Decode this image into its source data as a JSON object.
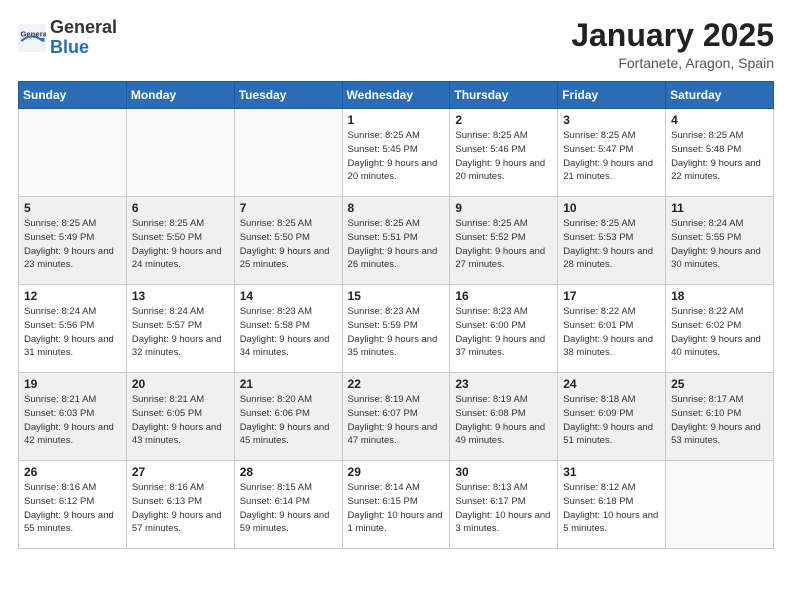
{
  "header": {
    "logo_general": "General",
    "logo_blue": "Blue",
    "month": "January 2025",
    "location": "Fortanete, Aragon, Spain"
  },
  "weekdays": [
    "Sunday",
    "Monday",
    "Tuesday",
    "Wednesday",
    "Thursday",
    "Friday",
    "Saturday"
  ],
  "weeks": [
    [
      {
        "day": "",
        "sunrise": "",
        "sunset": "",
        "daylight": ""
      },
      {
        "day": "",
        "sunrise": "",
        "sunset": "",
        "daylight": ""
      },
      {
        "day": "",
        "sunrise": "",
        "sunset": "",
        "daylight": ""
      },
      {
        "day": "1",
        "sunrise": "Sunrise: 8:25 AM",
        "sunset": "Sunset: 5:45 PM",
        "daylight": "Daylight: 9 hours and 20 minutes."
      },
      {
        "day": "2",
        "sunrise": "Sunrise: 8:25 AM",
        "sunset": "Sunset: 5:46 PM",
        "daylight": "Daylight: 9 hours and 20 minutes."
      },
      {
        "day": "3",
        "sunrise": "Sunrise: 8:25 AM",
        "sunset": "Sunset: 5:47 PM",
        "daylight": "Daylight: 9 hours and 21 minutes."
      },
      {
        "day": "4",
        "sunrise": "Sunrise: 8:25 AM",
        "sunset": "Sunset: 5:48 PM",
        "daylight": "Daylight: 9 hours and 22 minutes."
      }
    ],
    [
      {
        "day": "5",
        "sunrise": "Sunrise: 8:25 AM",
        "sunset": "Sunset: 5:49 PM",
        "daylight": "Daylight: 9 hours and 23 minutes."
      },
      {
        "day": "6",
        "sunrise": "Sunrise: 8:25 AM",
        "sunset": "Sunset: 5:50 PM",
        "daylight": "Daylight: 9 hours and 24 minutes."
      },
      {
        "day": "7",
        "sunrise": "Sunrise: 8:25 AM",
        "sunset": "Sunset: 5:50 PM",
        "daylight": "Daylight: 9 hours and 25 minutes."
      },
      {
        "day": "8",
        "sunrise": "Sunrise: 8:25 AM",
        "sunset": "Sunset: 5:51 PM",
        "daylight": "Daylight: 9 hours and 26 minutes."
      },
      {
        "day": "9",
        "sunrise": "Sunrise: 8:25 AM",
        "sunset": "Sunset: 5:52 PM",
        "daylight": "Daylight: 9 hours and 27 minutes."
      },
      {
        "day": "10",
        "sunrise": "Sunrise: 8:25 AM",
        "sunset": "Sunset: 5:53 PM",
        "daylight": "Daylight: 9 hours and 28 minutes."
      },
      {
        "day": "11",
        "sunrise": "Sunrise: 8:24 AM",
        "sunset": "Sunset: 5:55 PM",
        "daylight": "Daylight: 9 hours and 30 minutes."
      }
    ],
    [
      {
        "day": "12",
        "sunrise": "Sunrise: 8:24 AM",
        "sunset": "Sunset: 5:56 PM",
        "daylight": "Daylight: 9 hours and 31 minutes."
      },
      {
        "day": "13",
        "sunrise": "Sunrise: 8:24 AM",
        "sunset": "Sunset: 5:57 PM",
        "daylight": "Daylight: 9 hours and 32 minutes."
      },
      {
        "day": "14",
        "sunrise": "Sunrise: 8:23 AM",
        "sunset": "Sunset: 5:58 PM",
        "daylight": "Daylight: 9 hours and 34 minutes."
      },
      {
        "day": "15",
        "sunrise": "Sunrise: 8:23 AM",
        "sunset": "Sunset: 5:59 PM",
        "daylight": "Daylight: 9 hours and 35 minutes."
      },
      {
        "day": "16",
        "sunrise": "Sunrise: 8:23 AM",
        "sunset": "Sunset: 6:00 PM",
        "daylight": "Daylight: 9 hours and 37 minutes."
      },
      {
        "day": "17",
        "sunrise": "Sunrise: 8:22 AM",
        "sunset": "Sunset: 6:01 PM",
        "daylight": "Daylight: 9 hours and 38 minutes."
      },
      {
        "day": "18",
        "sunrise": "Sunrise: 8:22 AM",
        "sunset": "Sunset: 6:02 PM",
        "daylight": "Daylight: 9 hours and 40 minutes."
      }
    ],
    [
      {
        "day": "19",
        "sunrise": "Sunrise: 8:21 AM",
        "sunset": "Sunset: 6:03 PM",
        "daylight": "Daylight: 9 hours and 42 minutes."
      },
      {
        "day": "20",
        "sunrise": "Sunrise: 8:21 AM",
        "sunset": "Sunset: 6:05 PM",
        "daylight": "Daylight: 9 hours and 43 minutes."
      },
      {
        "day": "21",
        "sunrise": "Sunrise: 8:20 AM",
        "sunset": "Sunset: 6:06 PM",
        "daylight": "Daylight: 9 hours and 45 minutes."
      },
      {
        "day": "22",
        "sunrise": "Sunrise: 8:19 AM",
        "sunset": "Sunset: 6:07 PM",
        "daylight": "Daylight: 9 hours and 47 minutes."
      },
      {
        "day": "23",
        "sunrise": "Sunrise: 8:19 AM",
        "sunset": "Sunset: 6:08 PM",
        "daylight": "Daylight: 9 hours and 49 minutes."
      },
      {
        "day": "24",
        "sunrise": "Sunrise: 8:18 AM",
        "sunset": "Sunset: 6:09 PM",
        "daylight": "Daylight: 9 hours and 51 minutes."
      },
      {
        "day": "25",
        "sunrise": "Sunrise: 8:17 AM",
        "sunset": "Sunset: 6:10 PM",
        "daylight": "Daylight: 9 hours and 53 minutes."
      }
    ],
    [
      {
        "day": "26",
        "sunrise": "Sunrise: 8:16 AM",
        "sunset": "Sunset: 6:12 PM",
        "daylight": "Daylight: 9 hours and 55 minutes."
      },
      {
        "day": "27",
        "sunrise": "Sunrise: 8:16 AM",
        "sunset": "Sunset: 6:13 PM",
        "daylight": "Daylight: 9 hours and 57 minutes."
      },
      {
        "day": "28",
        "sunrise": "Sunrise: 8:15 AM",
        "sunset": "Sunset: 6:14 PM",
        "daylight": "Daylight: 9 hours and 59 minutes."
      },
      {
        "day": "29",
        "sunrise": "Sunrise: 8:14 AM",
        "sunset": "Sunset: 6:15 PM",
        "daylight": "Daylight: 10 hours and 1 minute."
      },
      {
        "day": "30",
        "sunrise": "Sunrise: 8:13 AM",
        "sunset": "Sunset: 6:17 PM",
        "daylight": "Daylight: 10 hours and 3 minutes."
      },
      {
        "day": "31",
        "sunrise": "Sunrise: 8:12 AM",
        "sunset": "Sunset: 6:18 PM",
        "daylight": "Daylight: 10 hours and 5 minutes."
      },
      {
        "day": "",
        "sunrise": "",
        "sunset": "",
        "daylight": ""
      }
    ]
  ]
}
